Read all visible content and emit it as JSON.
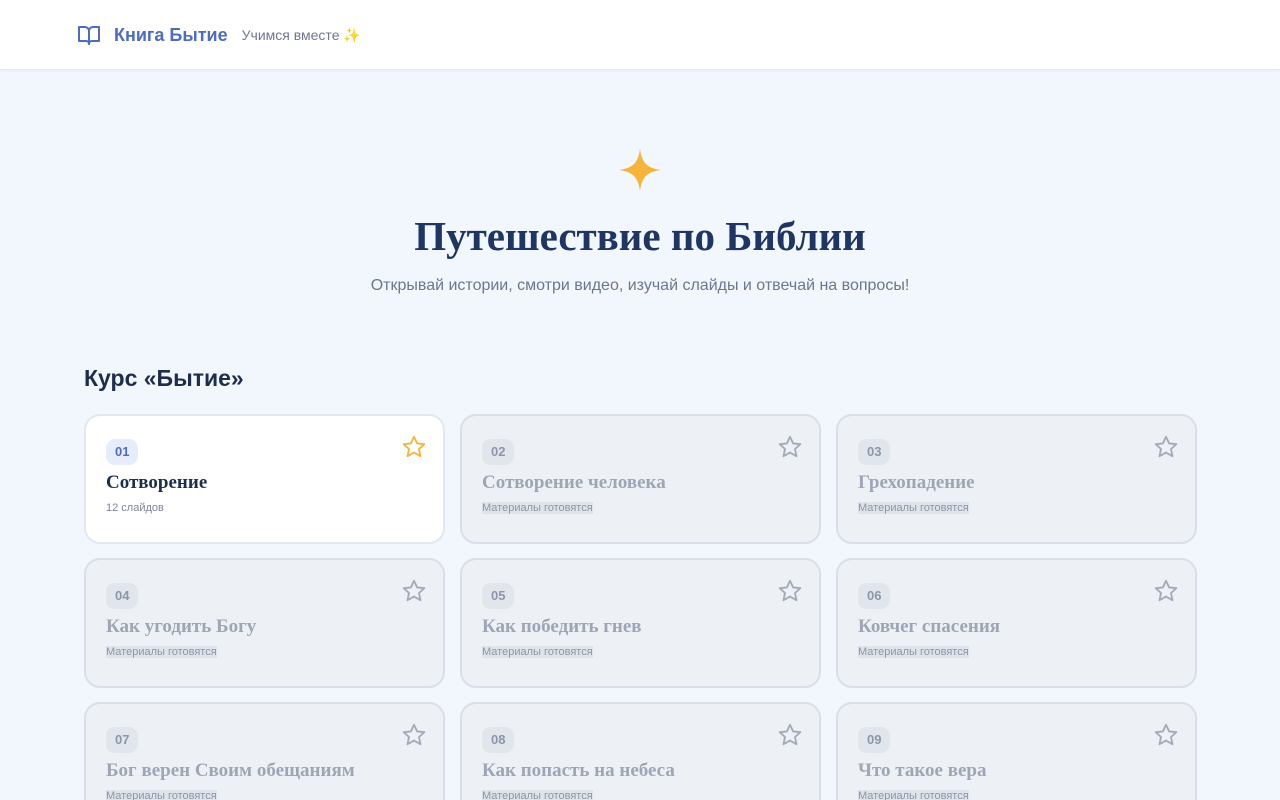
{
  "header": {
    "brand_name": "Книга Бытие",
    "tagline": "Учимся вместе ✨"
  },
  "hero": {
    "title": "Путешествие по Библии",
    "subtitle": "Открывай истории, смотри видео, изучай слайды и отвечай на вопросы!"
  },
  "course": {
    "title": "Курс «Бытие»",
    "lessons": [
      {
        "number": "01",
        "title": "Сотворение",
        "meta": "12 слайдов",
        "locked": false
      },
      {
        "number": "02",
        "title": "Сотворение человека",
        "meta": "Материалы готовятся",
        "locked": true
      },
      {
        "number": "03",
        "title": "Грехопадение",
        "meta": "Материалы готовятся",
        "locked": true
      },
      {
        "number": "04",
        "title": "Как угодить Богу",
        "meta": "Материалы готовятся",
        "locked": true
      },
      {
        "number": "05",
        "title": "Как победить гнев",
        "meta": "Материалы готовятся",
        "locked": true
      },
      {
        "number": "06",
        "title": "Ковчег спасения",
        "meta": "Материалы готовятся",
        "locked": true
      },
      {
        "number": "07",
        "title": "Бог верен Своим обещаниям",
        "meta": "Материалы готовятся",
        "locked": true
      },
      {
        "number": "08",
        "title": "Как попасть на небеса",
        "meta": "Материалы готовятся",
        "locked": true
      },
      {
        "number": "09",
        "title": "Что такое вера",
        "meta": "Материалы готовятся",
        "locked": true
      }
    ]
  },
  "icons": {
    "brand": "open-book-icon",
    "hero": "sparkle-icon",
    "lesson": "star-icon"
  },
  "colors": {
    "brand": "#4f6bc0",
    "accent_star": "#f5b43c",
    "title": "#1f3563",
    "background": "#f2f6fd"
  }
}
